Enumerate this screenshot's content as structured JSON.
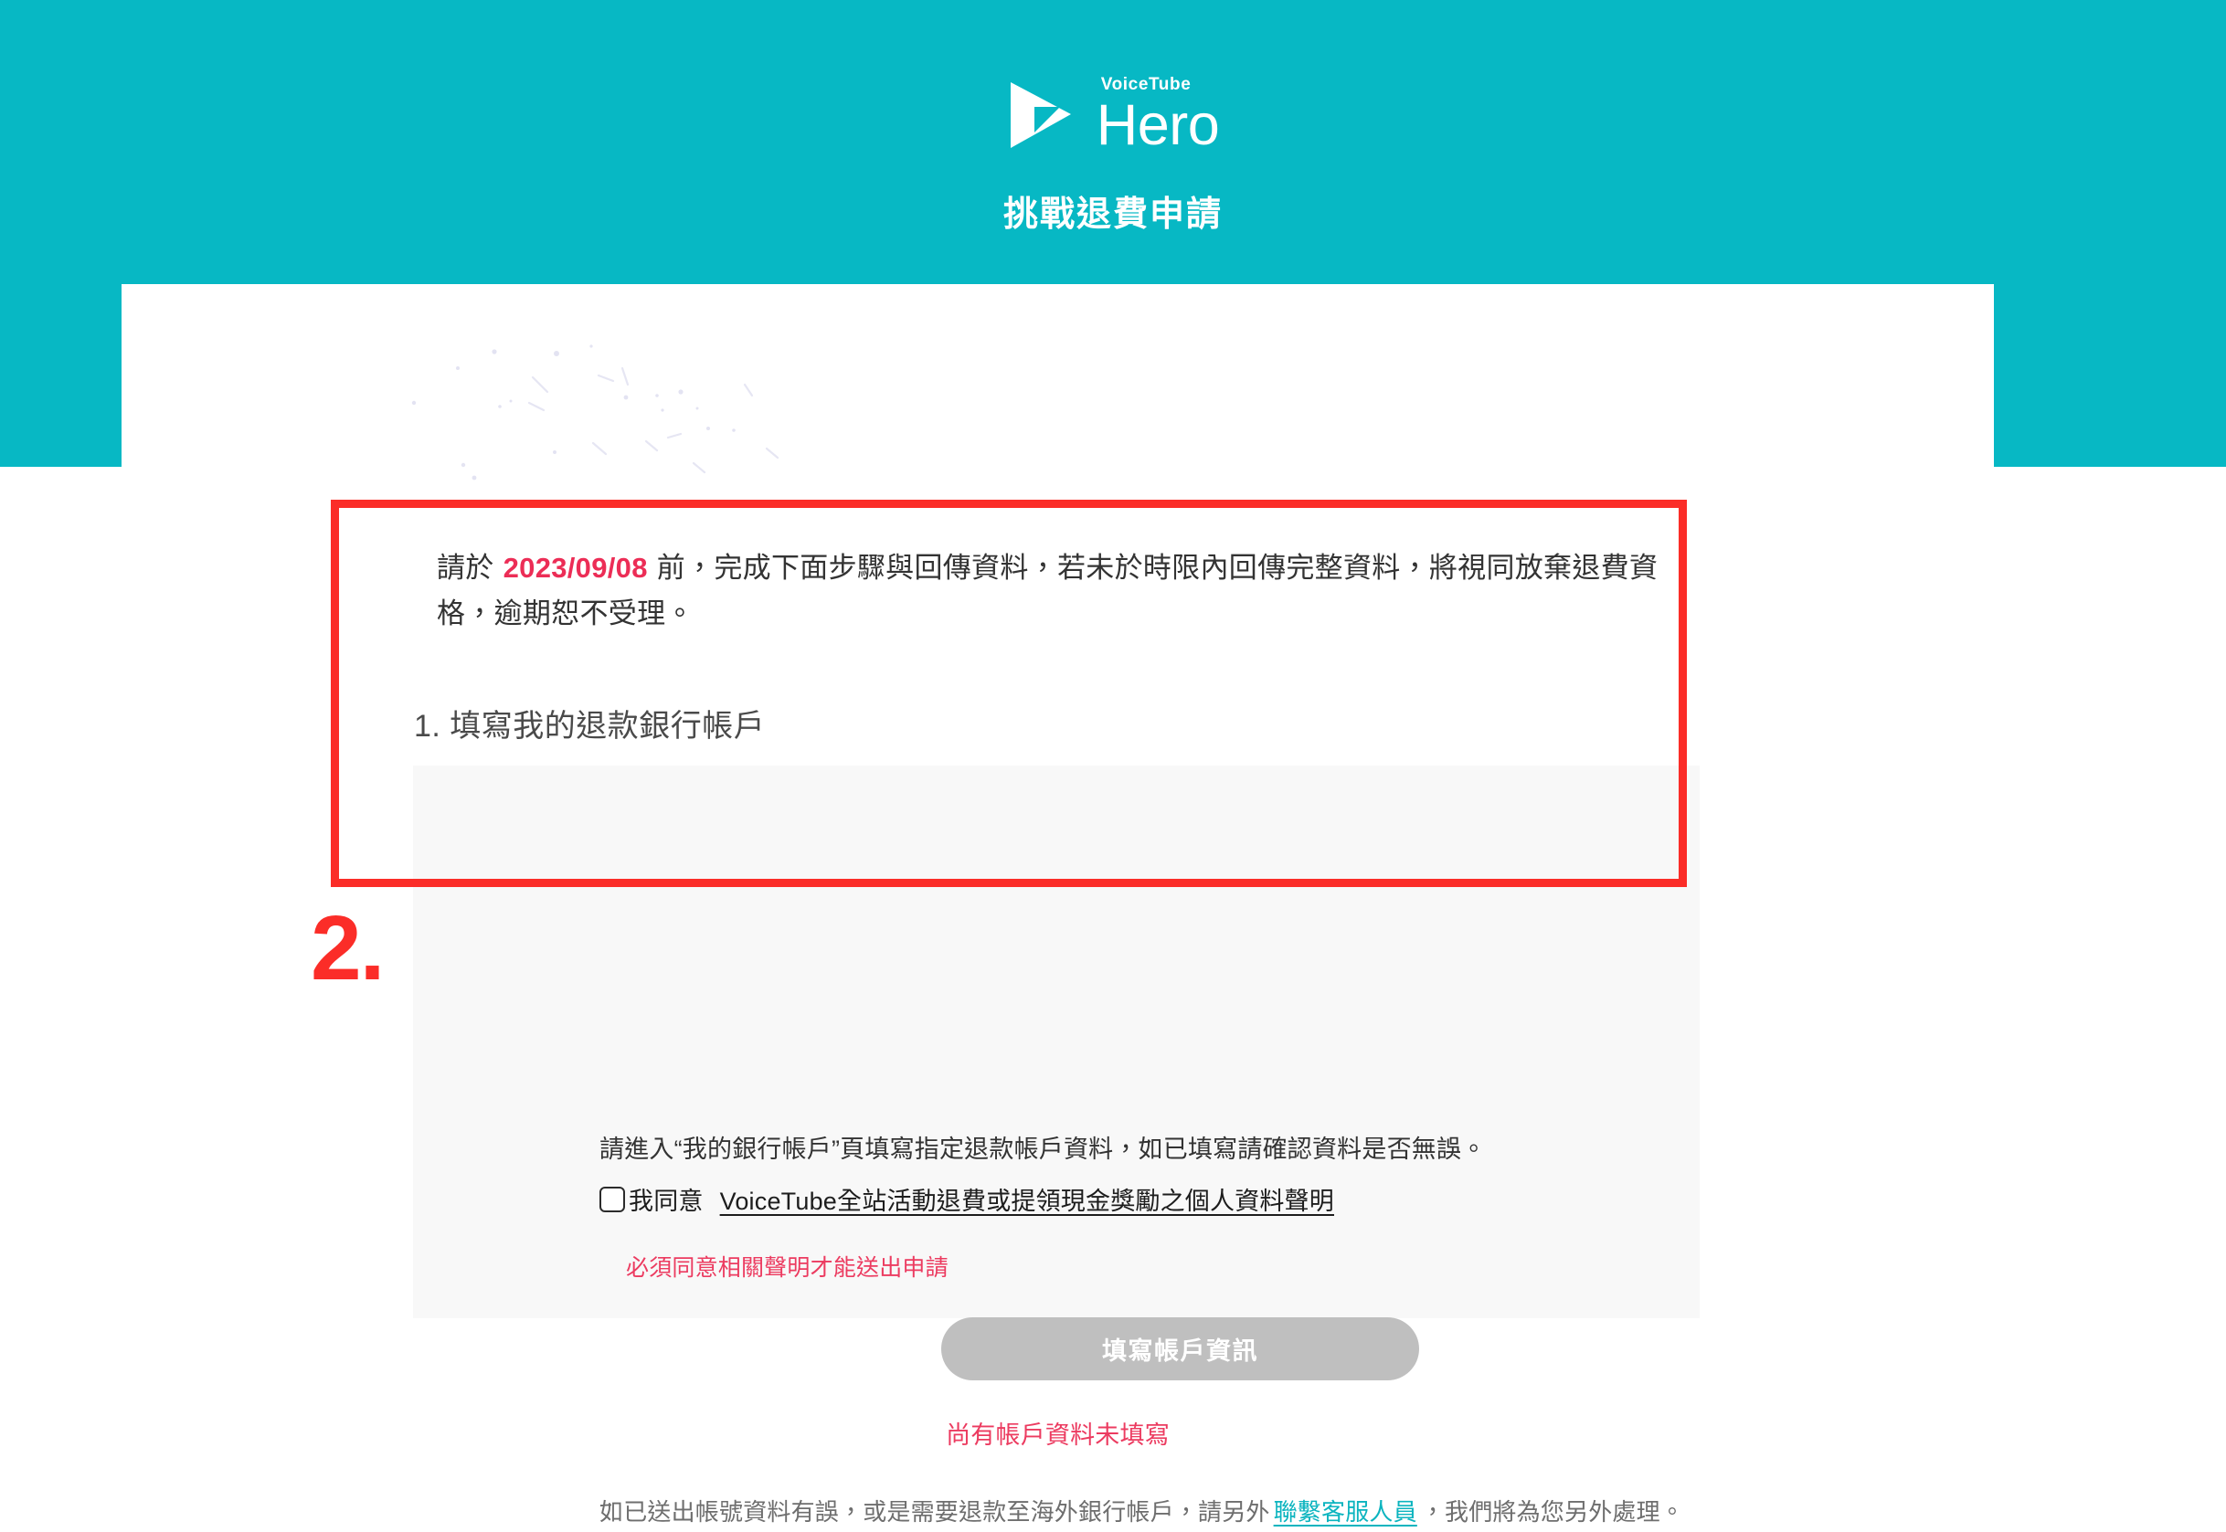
{
  "brand": {
    "sub": "VoiceTube",
    "name": "Hero",
    "logo_icon": "play-triangle-icon"
  },
  "header": {
    "title": "挑戰退費申請",
    "background_color": "#07b8c4"
  },
  "notice": {
    "prefix": "請於",
    "deadline_date": "2023/09/08",
    "suffix": "前，完成下面步驟與回傳資料，若未於時限內回傳完整資料，將視同放棄退費資格，逾期恕不受理。",
    "date_color": "#ec2d56"
  },
  "step": {
    "heading": "1. 填寫我的退款銀行帳戶"
  },
  "annotation": {
    "number": "2.",
    "color": "#fb2d28"
  },
  "card": {
    "lead_text": "請進入“我的銀行帳戶”頁填寫指定退款帳戶資料，如已填寫請確認資料是否無誤。",
    "consent": {
      "checkbox_checked": false,
      "label": "我同意",
      "link_text": "VoiceTube全站活動退費或提領現金獎勵之個人資料聲明",
      "error_text": "必須同意相關聲明才能送出申請"
    },
    "submit": {
      "label": "填寫帳戶資訊",
      "disabled": true,
      "error_text": "尚有帳戶資料未填寫",
      "background_color": "#bfbfbf"
    },
    "footnote": {
      "before": "如已送出帳號資料有誤，或是需要退款至海外銀行帳戶，請另外",
      "link_text": "聯繫客服人員",
      "after": "，我們將為您另外處理。",
      "link_color": "#0bb4bf"
    }
  }
}
